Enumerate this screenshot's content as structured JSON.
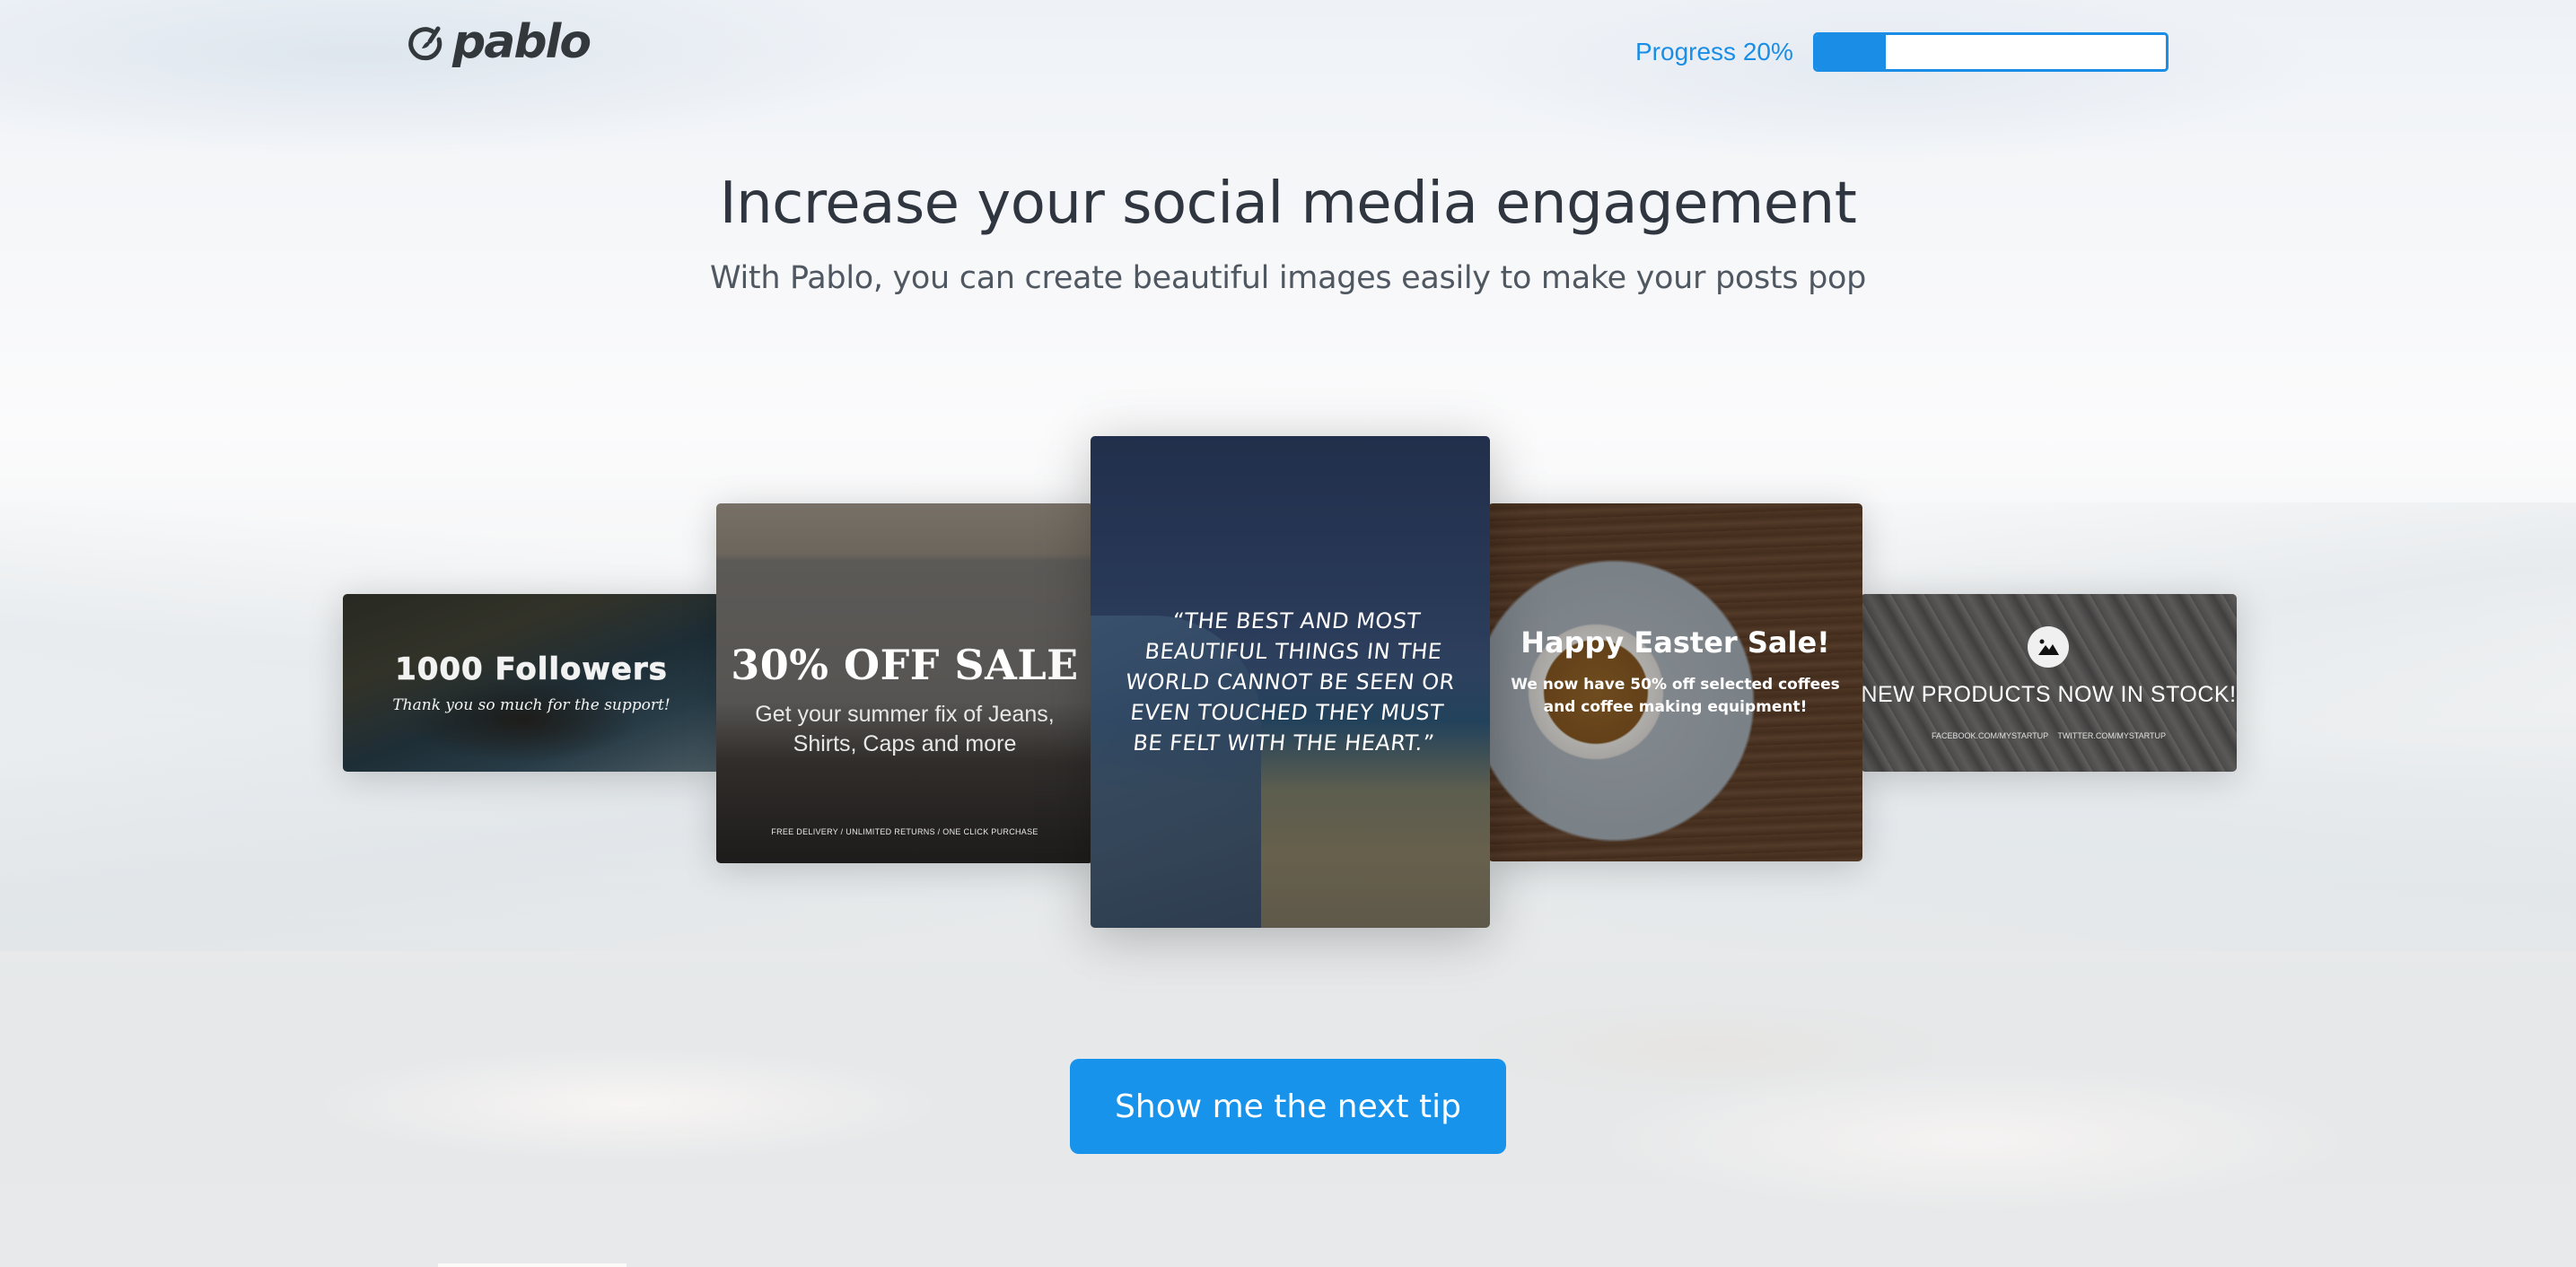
{
  "header": {
    "logo_text": "pablo",
    "progress": {
      "label": "Progress 20%",
      "value_percent": 20,
      "color": "#1a8ee6"
    }
  },
  "hero": {
    "title": "Increase your social media engagement",
    "subtitle": "With Pablo, you can create beautiful images easily to make your posts pop"
  },
  "cards": {
    "followers": {
      "title": "1000 Followers",
      "subtitle": "Thank you so much for the support!"
    },
    "sale": {
      "title": "30% OFF SALE",
      "subtitle_line1": "Get your summer fix of Jeans,",
      "subtitle_line2": "Shirts, Caps and more",
      "footer": "FREE DELIVERY / UNLIMITED RETURNS / ONE CLICK PURCHASE"
    },
    "quote": {
      "text": "“The best and most beautiful things in the world cannot be seen or even touched they must be felt with the heart.”"
    },
    "easter": {
      "title": "Happy Easter Sale!",
      "subtitle_line1": "We now have 50% off selected coffees",
      "subtitle_line2": "and coffee making equipment!"
    },
    "products": {
      "icon": "image-icon",
      "title": "NEW PRODUCTS NOW IN STOCK!",
      "footer": "FACEBOOK.COM/MYSTARTUP TWITTER.COM/MYSTARTUP"
    }
  },
  "cta": {
    "label": "Show me the next tip",
    "color": "#1793ec"
  }
}
